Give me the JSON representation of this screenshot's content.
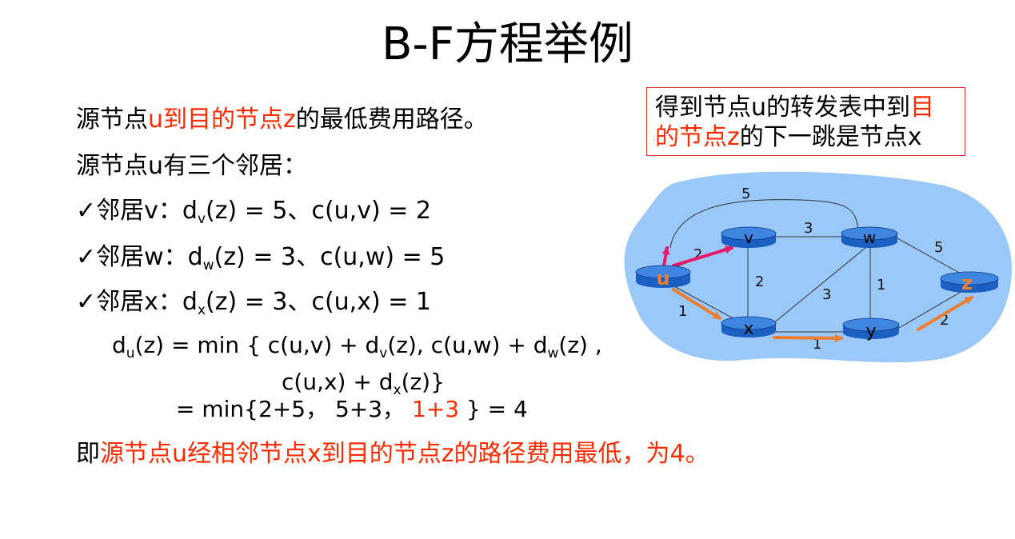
{
  "title": "B-F方程举例",
  "lines": {
    "l1_a": "源节点",
    "l1_b": "u到目的节点z",
    "l1_c": "的最低费用路径。",
    "l2": "源节点u有三个邻居：",
    "l3_check": "✓",
    "l3_a": "邻居v：d",
    "l3_sub": "v",
    "l3_b": "(z) = 5、c(u,v) = 2",
    "l4_check": "✓",
    "l4_a": "邻居w：d",
    "l4_sub": "w",
    "l4_b": "(z) = 3、c(u,w) = 5",
    "l5_check": "✓",
    "l5_a": "邻居x：d",
    "l5_sub": "x",
    "l5_b": "(z) = 3、c(u,x) = 1"
  },
  "formula": {
    "f1_a": "d",
    "f1_sub_u": "u",
    "f1_b": "(z)  =  min { c(u,v) + d",
    "f1_sub_v": "v",
    "f1_c": "(z), c(u,w) + d",
    "f1_sub_w": "w",
    "f1_d": "(z) ,",
    "f2_a": "c(u,x) + d",
    "f2_sub_x": "x",
    "f2_b": "(z)}",
    "f3_a": "= min{2+5，  5+3，",
    "f3_red": "1+3",
    "f3_b": "} = 4"
  },
  "conclusion": {
    "a": "即",
    "b": "源节点u经相邻节点x到目的节点z的路径费用最低，为4。"
  },
  "callout": {
    "a": "得到节点u的转发表中到",
    "b": "目的节点z",
    "c": "的下一跳是节点x"
  },
  "network": {
    "nodes": {
      "u": "u",
      "v": "v",
      "w": "w",
      "x": "x",
      "y": "y",
      "z": "z"
    },
    "costs": {
      "uv": "2",
      "ux": "1",
      "vw": "3",
      "vx": "2",
      "wx": "3",
      "wy": "1",
      "xy": "1",
      "yz": "2",
      "wz": "5",
      "uw": "5"
    },
    "colors": {
      "cloud": "#9ac8f8",
      "router": "#1c5fc2",
      "path_uv": "#e8186b",
      "path_orange": "#ed7d31"
    }
  }
}
